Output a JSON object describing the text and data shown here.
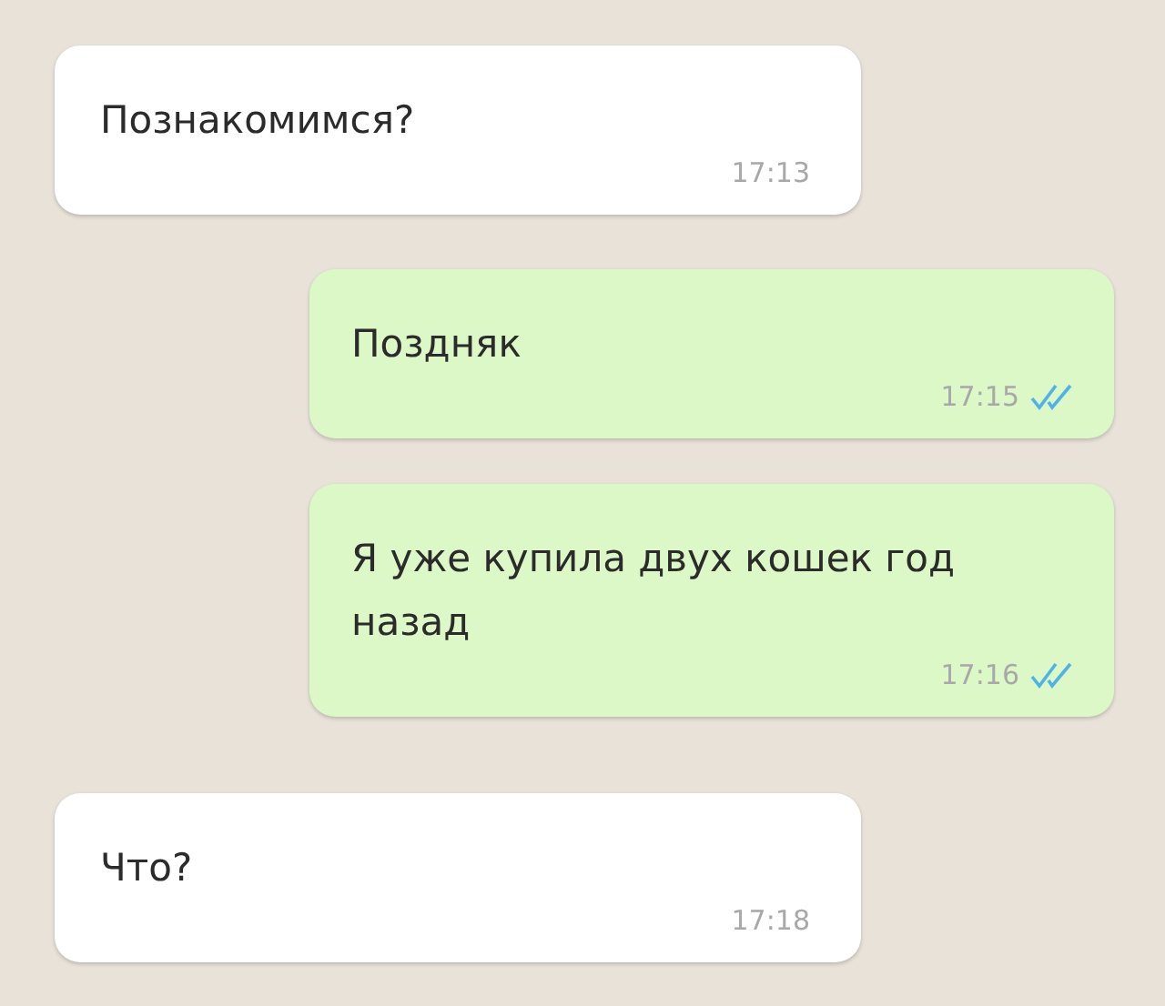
{
  "messages": [
    {
      "kind": "incoming",
      "text": "Познакомимся?",
      "time": "17:13"
    },
    {
      "kind": "outgoing",
      "text": "Поздняк",
      "time": "17:15",
      "read": true
    },
    {
      "kind": "outgoing",
      "text": "Я уже купила двух кошек год назад",
      "time": "17:16",
      "read": true
    },
    {
      "kind": "incoming",
      "text": "Что?",
      "time": "17:18"
    }
  ]
}
